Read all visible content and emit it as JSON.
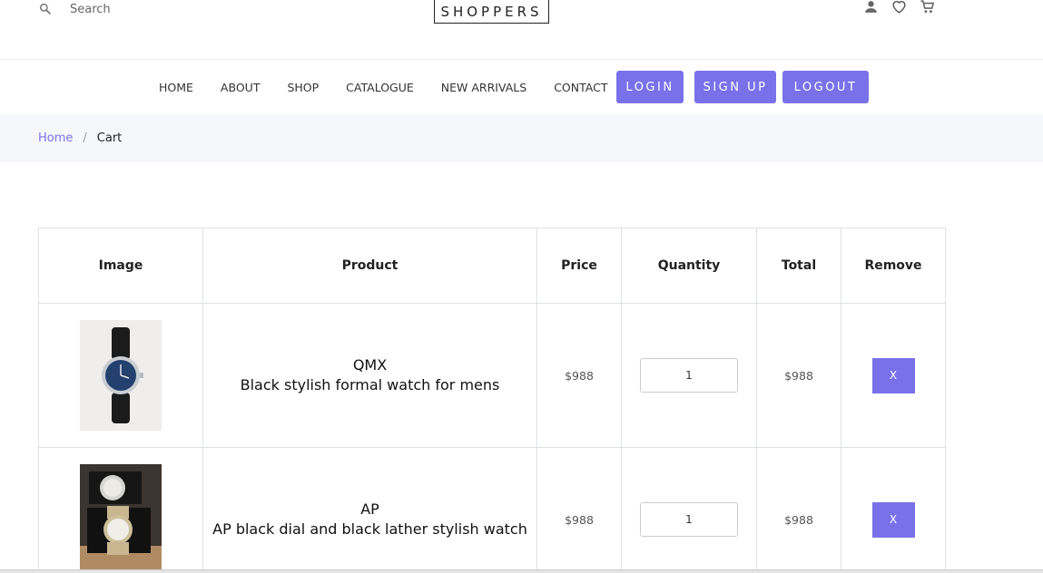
{
  "header": {
    "search_placeholder": "Search",
    "brand": "SHOPPERS",
    "icons": [
      "person-icon",
      "heart-icon",
      "cart-icon"
    ]
  },
  "nav": {
    "links": [
      "HOME",
      "ABOUT",
      "SHOP",
      "CATALOGUE",
      "NEW ARRIVALS",
      "CONTACT"
    ],
    "login": "LOGIN",
    "signup": "SIGN UP",
    "logout": "LOGOUT"
  },
  "breadcrumb": {
    "home": "Home",
    "separator": "/",
    "current": "Cart"
  },
  "table": {
    "headers": [
      "Image",
      "Product",
      "Price",
      "Quantity",
      "Total",
      "Remove"
    ],
    "rows": [
      {
        "brand": "QMX",
        "description": "Black stylish formal watch for mens",
        "price": "$988",
        "quantity": "1",
        "total": "$988",
        "remove": "X"
      },
      {
        "brand": "AP",
        "description": "AP black dial and black lather stylish watch",
        "price": "$988",
        "quantity": "1",
        "total": "$988",
        "remove": "X"
      }
    ]
  },
  "colors": {
    "accent": "#7971ea",
    "breadcrumb_bg": "#f6f7fa",
    "border": "#dee2e6"
  }
}
